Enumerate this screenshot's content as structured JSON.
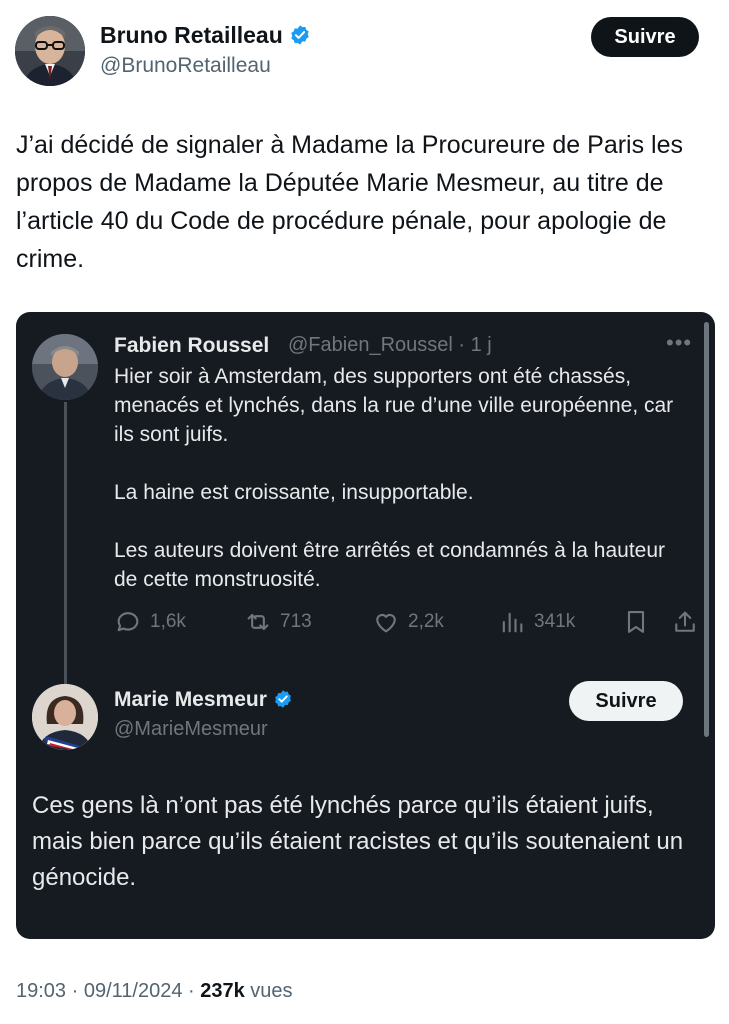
{
  "author": {
    "name": "Bruno Retailleau",
    "handle": "@BrunoRetailleau",
    "follow_label": "Suivre"
  },
  "tweet": {
    "text": "J’ai décidé de signaler à Madame la Procureure de Paris les propos de Madame la Députée Marie Mesmeur, au titre de l’article 40 du Code de procédure pénale, pour apologie de crime."
  },
  "quoted_thread": {
    "first": {
      "name": "Fabien Roussel",
      "handle_time": "@Fabien_Roussel · 1 j",
      "paragraphs": [
        "Hier soir à Amsterdam, des supporters ont été chassés, menacés et lynchés, dans la rue d’une ville européenne, car ils sont juifs.",
        "La haine est croissante, insupportable.",
        "Les auteurs doivent être arrêtés et condamnés à la hauteur de cette monstruosité."
      ],
      "actions": {
        "replies": "1,6k",
        "reposts": "713",
        "likes": "2,2k",
        "views": "341k"
      }
    },
    "second": {
      "name": "Marie Mesmeur",
      "handle": "@MarieMesmeur",
      "follow_label": "Suivre",
      "text": "Ces gens là n’ont pas été lynchés parce qu’ils étaient juifs, mais bien parce qu’ils étaient racistes et qu’ils soutenaient un génocide."
    }
  },
  "footer": {
    "time_date": "19:03 · 09/11/2024 · ",
    "views_count": "237k",
    "views_label": " vues"
  },
  "colors": {
    "verified_blue": "#1d9bf0",
    "card_bg": "#161b22",
    "muted": "#71767b"
  }
}
